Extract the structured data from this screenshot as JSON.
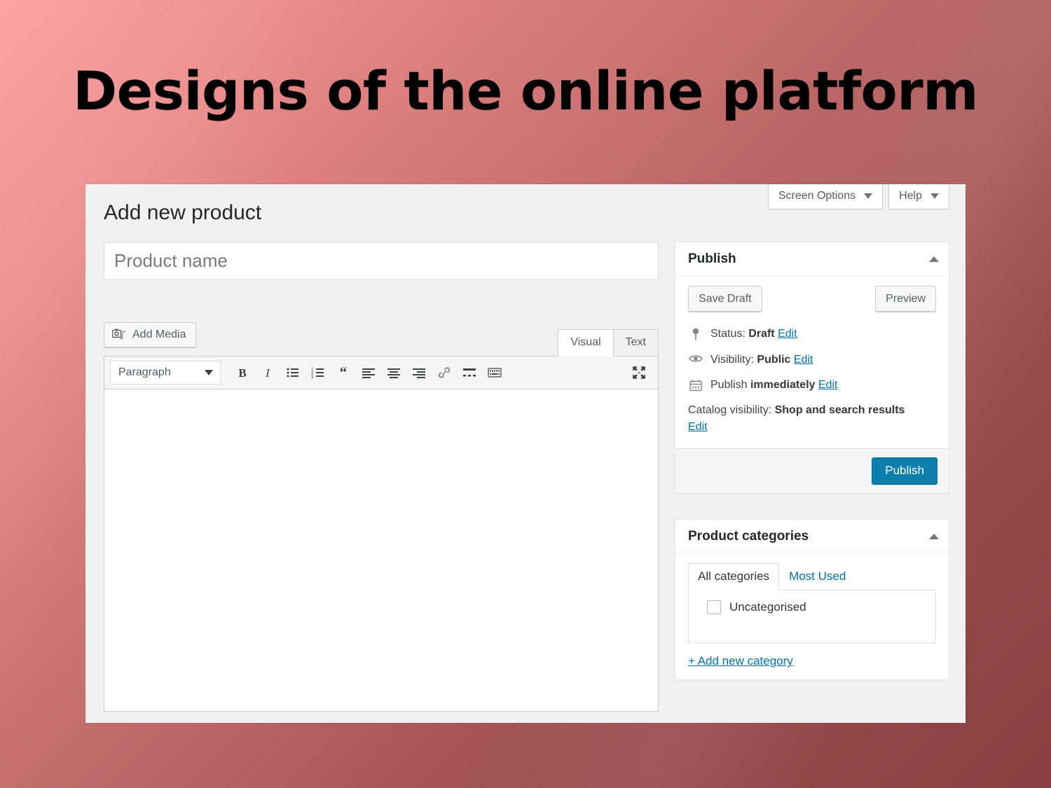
{
  "slide": {
    "title": "Designs of the online platform"
  },
  "screen": {
    "heading": "Add new product",
    "top_buttons": [
      {
        "label": "Screen Options",
        "icon": "chevron-down-icon"
      },
      {
        "label": "Help",
        "icon": "chevron-down-icon"
      }
    ]
  },
  "editor": {
    "title_placeholder": "Product name",
    "title_value": "",
    "add_media_label": "Add Media",
    "tabs": [
      {
        "label": "Visual",
        "active": true
      },
      {
        "label": "Text",
        "active": false
      }
    ],
    "format_select": "Paragraph",
    "toolbar_buttons": [
      "bold-icon",
      "italic-icon",
      "bulleted-list-icon",
      "numbered-list-icon",
      "blockquote-icon",
      "align-left-icon",
      "align-center-icon",
      "align-right-icon",
      "link-icon",
      "read-more-icon",
      "toolbar-toggle-icon"
    ],
    "fullscreen_icon": "fullscreen-icon",
    "content": ""
  },
  "publish_box": {
    "title": "Publish",
    "collapse_icon": "chevron-up-icon",
    "save_draft_label": "Save Draft",
    "preview_label": "Preview",
    "status": {
      "icon": "pin-icon",
      "label": "Status:",
      "value": "Draft",
      "edit": "Edit"
    },
    "visibility": {
      "icon": "eye-icon",
      "label": "Visibility:",
      "value": "Public",
      "edit": "Edit"
    },
    "schedule": {
      "icon": "calendar-icon",
      "label": "Publish",
      "value": "immediately",
      "edit": "Edit"
    },
    "catalog": {
      "label": "Catalog visibility:",
      "value": "Shop and search results",
      "edit": "Edit"
    },
    "publish_label": "Publish",
    "publish_color": "#0e7fad"
  },
  "categories_box": {
    "title": "Product categories",
    "collapse_icon": "chevron-up-icon",
    "tabs": [
      {
        "label": "All categories",
        "active": true
      },
      {
        "label": "Most Used",
        "active": false
      }
    ],
    "items": [
      {
        "label": "Uncategorised",
        "checked": false
      }
    ],
    "add_new_label": "+ Add new category"
  },
  "theme": {
    "bg_light": "#fb9090",
    "bg_dark": "#87403f",
    "panel_bg": "#f1f1f1",
    "link_color": "#0073aa"
  }
}
